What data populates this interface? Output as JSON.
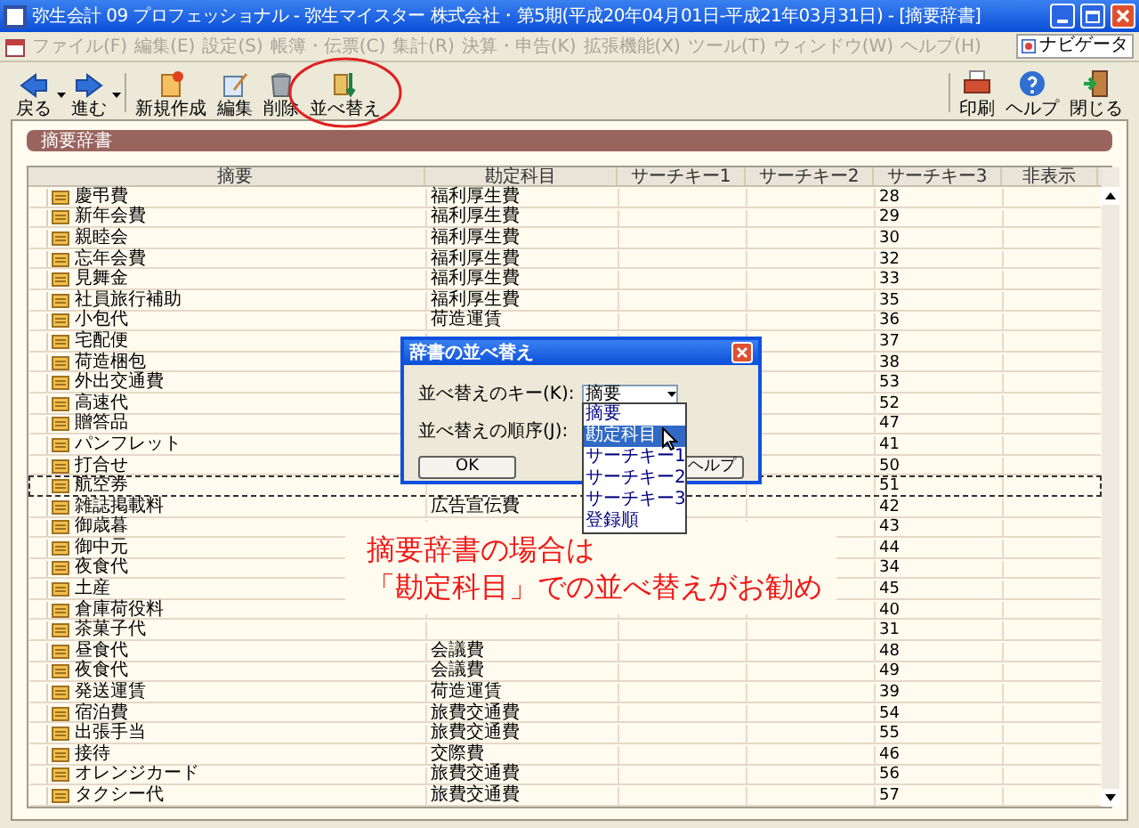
{
  "window": {
    "title": "弥生会計 09 プロフェッショナル - 弥生マイスター 株式会社・第5期(平成20年04月01日-平成21年03月31日) - [摘要辞書]"
  },
  "menu": [
    {
      "label": "ファイル(F)",
      "disabled": true
    },
    {
      "label": "編集(E)",
      "disabled": true
    },
    {
      "label": "設定(S)",
      "disabled": true
    },
    {
      "label": "帳簿・伝票(C)",
      "disabled": true
    },
    {
      "label": "集計(R)",
      "disabled": true
    },
    {
      "label": "決算・申告(K)",
      "disabled": true
    },
    {
      "label": "拡張機能(X)",
      "disabled": true
    },
    {
      "label": "ツール(T)",
      "disabled": true
    },
    {
      "label": "ウィンドウ(W)",
      "disabled": true
    },
    {
      "label": "ヘルプ(H)",
      "disabled": true
    }
  ],
  "navigator": "ナビゲータ",
  "toolbar": {
    "left": [
      {
        "kind": "back",
        "label": "戻る",
        "dropdown": true,
        "circled": false
      },
      {
        "kind": "forward",
        "label": "進む",
        "dropdown": true,
        "circled": false
      },
      {
        "kind": "new",
        "label": "新規作成",
        "dropdown": false,
        "circled": false
      },
      {
        "kind": "edit",
        "label": "編集",
        "dropdown": false,
        "circled": false
      },
      {
        "kind": "delete",
        "label": "削除",
        "dropdown": false,
        "circled": false
      },
      {
        "kind": "sort",
        "label": "並べ替え",
        "dropdown": false,
        "circled": true
      }
    ],
    "right": [
      {
        "kind": "print",
        "label": "印刷"
      },
      {
        "kind": "help",
        "label": "ヘルプ"
      },
      {
        "kind": "close",
        "label": "閉じる"
      }
    ]
  },
  "panel_title": "摘要辞書",
  "table": {
    "columns": [
      "摘要",
      "勘定科目",
      "サーチキー1",
      "サーチキー2",
      "サーチキー3",
      "非表示"
    ],
    "rows": [
      {
        "summary": "慶弔費",
        "account": "福利厚生費",
        "key_3": "28",
        "focused": false
      },
      {
        "summary": "新年会費",
        "account": "福利厚生費",
        "key_3": "29",
        "focused": false
      },
      {
        "summary": "親睦会",
        "account": "福利厚生費",
        "key_3": "30",
        "focused": false
      },
      {
        "summary": "忘年会費",
        "account": "福利厚生費",
        "key_3": "32",
        "focused": false
      },
      {
        "summary": "見舞金",
        "account": "福利厚生費",
        "key_3": "33",
        "focused": false
      },
      {
        "summary": "社員旅行補助",
        "account": "福利厚生費",
        "key_3": "35",
        "focused": false
      },
      {
        "summary": "小包代",
        "account": "荷造運賃",
        "key_3": "36",
        "focused": false
      },
      {
        "summary": "宅配便",
        "key_3": "37",
        "focused": false
      },
      {
        "summary": "荷造梱包",
        "key_3": "38",
        "focused": false
      },
      {
        "summary": "外出交通費",
        "key_3": "53",
        "focused": false
      },
      {
        "summary": "高速代",
        "key_3": "52",
        "focused": false
      },
      {
        "summary": "贈答品",
        "key_3": "47",
        "focused": false
      },
      {
        "summary": "パンフレット",
        "key_3": "41",
        "focused": false
      },
      {
        "summary": "打合せ",
        "key_3": "50",
        "focused": false
      },
      {
        "summary": "航空券",
        "key_3": "51",
        "focused": true
      },
      {
        "summary": "雑誌掲載料",
        "account": "広告宣伝費",
        "key_3": "42",
        "focused": false
      },
      {
        "summary": "御歳暮",
        "key_3": "43",
        "focused": false
      },
      {
        "summary": "御中元",
        "key_3": "44",
        "focused": false
      },
      {
        "summary": "夜食代",
        "key_3": "34",
        "focused": false
      },
      {
        "summary": "土産",
        "key_3": "45",
        "focused": false
      },
      {
        "summary": "倉庫荷役料",
        "key_3": "40",
        "focused": false
      },
      {
        "summary": "茶菓子代",
        "key_3": "31",
        "focused": false
      },
      {
        "summary": "昼食代",
        "account": "会議費",
        "key_3": "48",
        "focused": false
      },
      {
        "summary": "夜食代",
        "account": "会議費",
        "key_3": "49",
        "focused": false
      },
      {
        "summary": "発送運賃",
        "account": "荷造運賃",
        "key_3": "39",
        "focused": false
      },
      {
        "summary": "宿泊費",
        "account": "旅費交通費",
        "key_3": "54",
        "focused": false
      },
      {
        "summary": "出張手当",
        "account": "旅費交通費",
        "key_3": "55",
        "focused": false
      },
      {
        "summary": "接待",
        "account": "交際費",
        "key_3": "46",
        "focused": false
      },
      {
        "summary": "オレンジカード",
        "account": "旅費交通費",
        "key_3": "56",
        "focused": false
      },
      {
        "summary": "タクシー代",
        "account": "旅費交通費",
        "key_3": "57",
        "focused": false
      }
    ]
  },
  "dialog": {
    "title": "辞書の並べ替え",
    "key_label": "並べ替えのキー(K):",
    "key_value": "摘要",
    "order_label": "並べ替えの順序(J):",
    "options": [
      {
        "label": "摘要",
        "selected": false
      },
      {
        "label": "勘定科目",
        "selected": true
      },
      {
        "label": "サーチキー1",
        "selected": false
      },
      {
        "label": "サーチキー2",
        "selected": false
      },
      {
        "label": "サーチキー3",
        "selected": false
      },
      {
        "label": "登録順",
        "selected": false
      }
    ],
    "ok": "OK",
    "help": "ヘルプ"
  },
  "annotation": [
    "摘要辞書の場合は",
    "「勘定科目」での並べ替えがお勧め"
  ]
}
